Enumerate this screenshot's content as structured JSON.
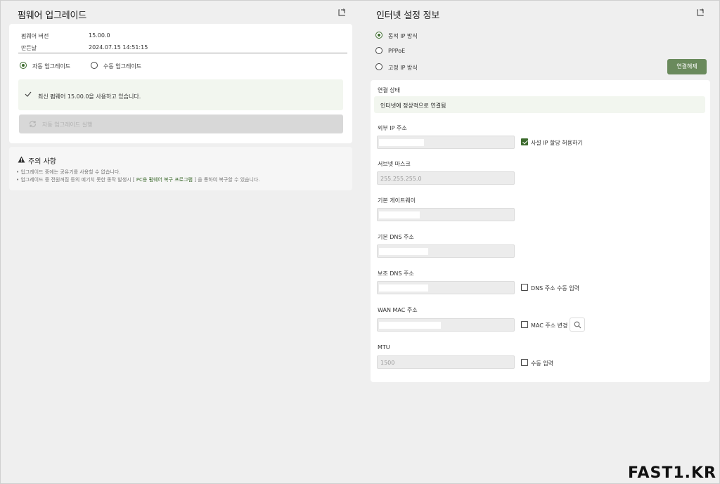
{
  "firmware": {
    "title": "펌웨어 업그레이드",
    "version_label": "펌웨어 버전",
    "version_value": "15.00.0",
    "date_label": "만든날",
    "date_value": "2024.07.15 14:51:15",
    "auto_upgrade_label": "자동 업그레이드",
    "manual_upgrade_label": "수동 업그레이드",
    "notice_text": "최신 펌웨어 15.00.0을 사용하고 있습니다.",
    "run_button_label": "자동 업그레이드 실행"
  },
  "caution": {
    "title": "주의 사항",
    "line1": "• 업그레이드 중에는 공유기를 사용할 수 없습니다.",
    "line2_prefix": "• 업그레이드 중 전원꺼짐 등의 예기치 못한 동작 발생시 [",
    "line2_link": "PC용 펌웨어 복구 프로그램",
    "line2_suffix": "] 을 통하여 복구할 수 있습니다."
  },
  "internet": {
    "title": "인터넷 설정 정보",
    "dynamic_ip_label": "동적 IP 방식",
    "pppoe_label": "PPPoE",
    "static_ip_label": "고정 IP 방식",
    "disconnect_button": "연결해제",
    "connection_status_label": "연결 상태",
    "connection_status_text": "인터넷에 정상적으로 연결됨",
    "external_ip_label": "외부 IP 주소",
    "private_ip_checkbox": "사설 IP 할당 허용하기",
    "subnet_label": "서브넷 마스크",
    "subnet_value": "255.255.255.0",
    "gateway_label": "기본 게이트웨이",
    "dns_label": "기본 DNS 주소",
    "secondary_dns_label": "보조 DNS 주소",
    "dns_manual_checkbox": "DNS 주소 수동 입력",
    "wan_mac_label": "WAN MAC 주소",
    "mac_change_checkbox": "MAC 주소 변경",
    "mtu_label": "MTU",
    "mtu_value": "1500",
    "mtu_manual_checkbox": "수동 입력"
  },
  "brand": "FAST1.KR",
  "colors": {
    "accent": "#3d6b2e",
    "button": "#6a8a5c",
    "notice_bg": "#f2f6ef"
  }
}
